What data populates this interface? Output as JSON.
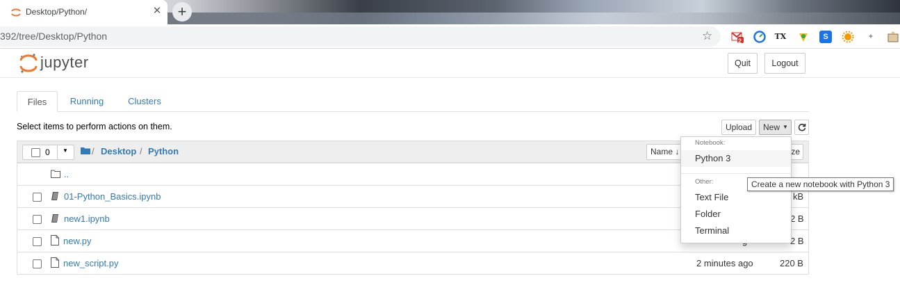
{
  "browser": {
    "tab_title": "Desktop/Python/",
    "url": "392/tree/Desktop/Python",
    "gmail_badge": "2"
  },
  "header": {
    "logo_text": "jupyter",
    "quit_label": "Quit",
    "logout_label": "Logout"
  },
  "tabs": [
    {
      "label": "Files",
      "active": true
    },
    {
      "label": "Running",
      "active": false
    },
    {
      "label": "Clusters",
      "active": false
    }
  ],
  "toolbar": {
    "hint": "Select items to perform actions on them.",
    "upload_label": "Upload",
    "new_label": "New"
  },
  "list": {
    "selected_count": "0",
    "breadcrumb": [
      "Desktop",
      "Python"
    ],
    "sort_name_label": "Name",
    "sort_size_label": "ze",
    "parent_label": "..",
    "rows": [
      {
        "name": "01-Python_Basics.ipynb",
        "type": "notebook",
        "modified": "",
        "size": "kB"
      },
      {
        "name": "new1.ipynb",
        "type": "notebook",
        "modified": "",
        "size": "2 B"
      },
      {
        "name": "new.py",
        "type": "file",
        "modified": "g",
        "size": "2 B"
      },
      {
        "name": "new_script.py",
        "type": "file",
        "modified": "2 minutes ago",
        "size": "220 B"
      }
    ]
  },
  "new_menu": {
    "notebook_header": "Notebook:",
    "notebook_items": [
      "Python 3"
    ],
    "other_header": "Other:",
    "other_items": [
      "Text File",
      "Folder",
      "Terminal"
    ],
    "tooltip": "Create a new notebook with Python 3"
  },
  "colors": {
    "link": "#337ab7",
    "jupyter_orange": "#f37726"
  }
}
